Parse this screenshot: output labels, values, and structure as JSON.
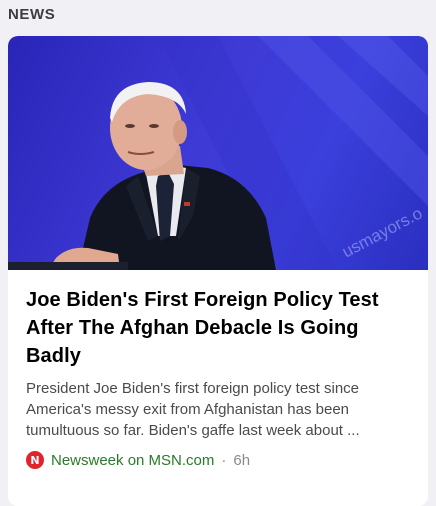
{
  "section": {
    "label": "NEWS"
  },
  "article": {
    "headline": "Joe Biden's First Foreign Policy Test After The Afghan Debacle Is Going Badly",
    "summary": "President Joe Biden's first foreign policy test since America's messy exit from Afghanistan has been tumultuous so far. Biden's gaffe last week about ...",
    "source": {
      "logo_letter": "N",
      "name": "Newsweek on MSN.com",
      "separator": "·",
      "time": "6h"
    },
    "image": {
      "icon": "news-photo",
      "backdrop_text": "usmayors.o"
    }
  },
  "colors": {
    "source_green": "#2a7a2a",
    "logo_red": "#e0242c",
    "backdrop_blue": "#3b3fdc"
  }
}
